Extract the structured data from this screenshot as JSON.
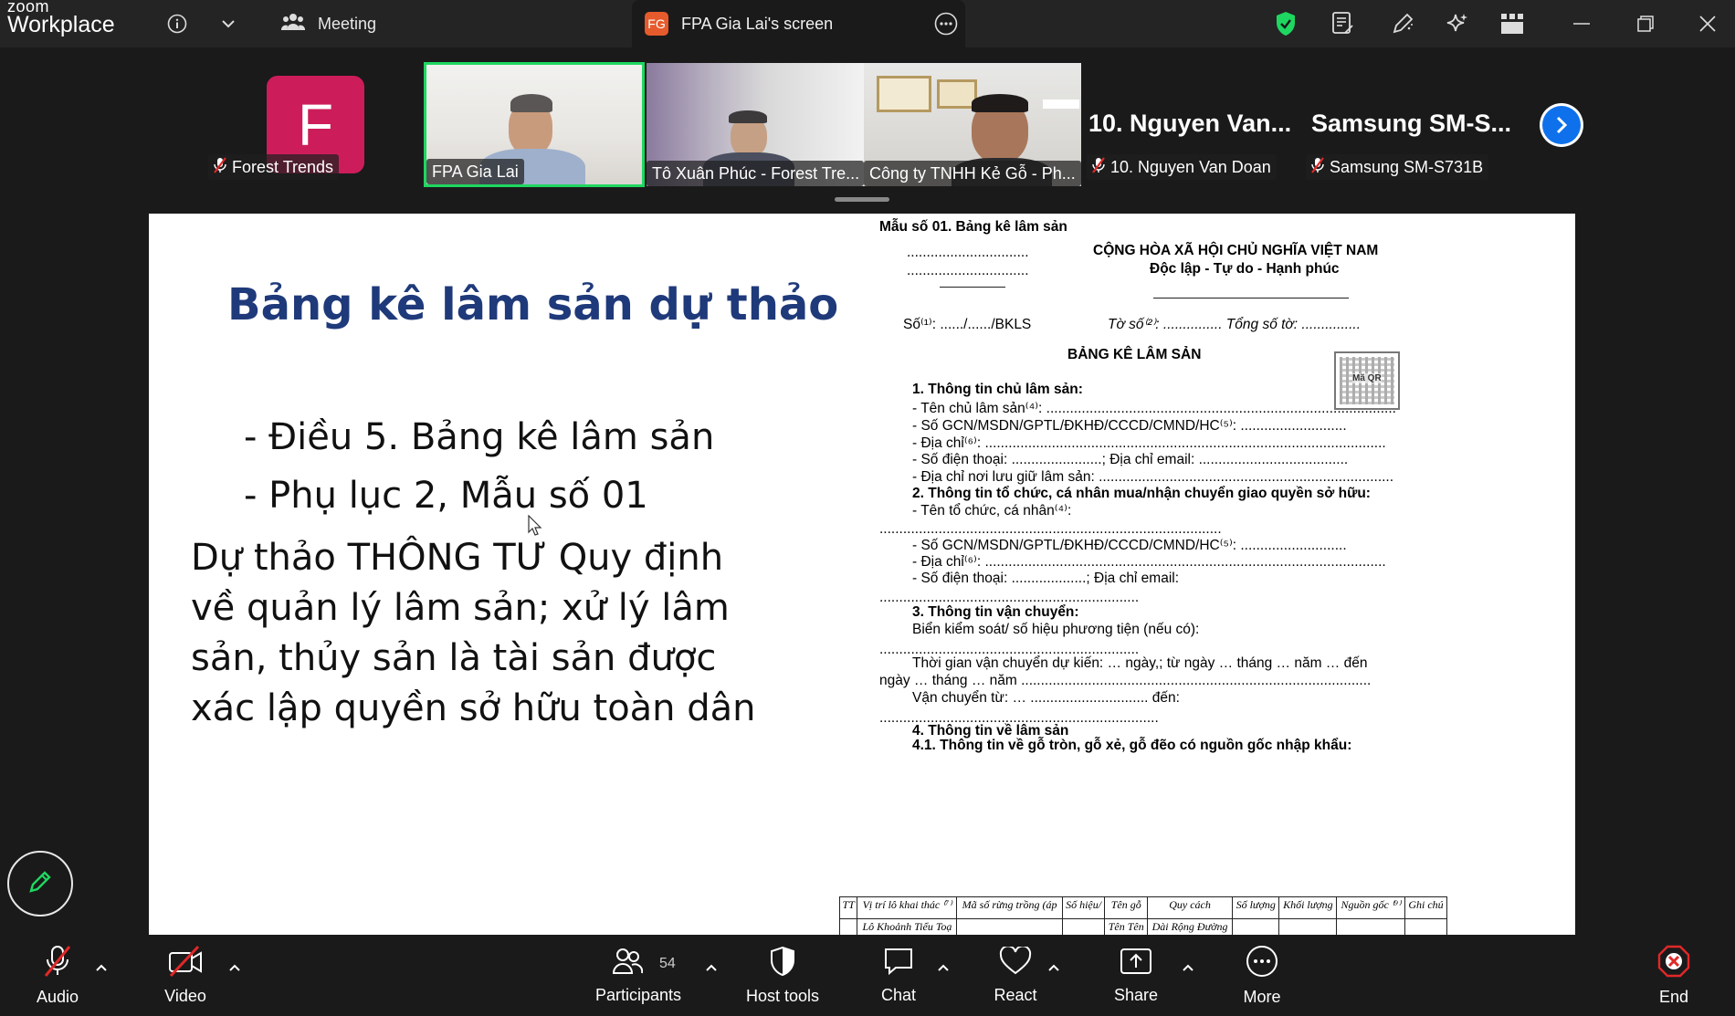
{
  "titlebar": {
    "brand_top": "zoom",
    "brand_bottom": "Workplace",
    "meeting_tab": "Meeting",
    "share_badge": "FG",
    "share_title": "FPA Gia Lai's screen"
  },
  "gallery": {
    "tiles": [
      {
        "label": "Forest Trends",
        "muted": true,
        "avatar_letter": "F"
      },
      {
        "label": "FPA Gia Lai",
        "muted": false,
        "active_speaker": true
      },
      {
        "label": "Tô Xuân Phúc - Forest Tre...",
        "muted": false
      },
      {
        "label": "Công ty TNHH Kẻ Gỗ - Ph...",
        "muted": false
      },
      {
        "label": "10. Nguyen Van Doan",
        "muted": true,
        "name_display": "10. Nguyen Van..."
      },
      {
        "label": "Samsung SM-S731B",
        "muted": true,
        "name_display": "Samsung SM-S..."
      }
    ]
  },
  "slide": {
    "title": "Bảng kê lâm sản dự thảo",
    "bullets": [
      "- Điều 5. Bảng kê lâm sản",
      "- Phụ lục 2, Mẫu số 01"
    ],
    "body": "Dự thảo THÔNG TƯ Quy định về quản lý lâm sản; xử lý lâm sản, thủy sản là tài sản được xác lập quyền sở hữu toàn dân"
  },
  "document": {
    "form_no": "Mẫu số 01. Bảng kê lâm sản",
    "dots_a": "...............................",
    "dots_b": "...............................",
    "nation": "CỘNG HÒA XÃ HỘI CHỦ NGHĨA VIỆT NAM",
    "motto": "Độc lập - Tự do - Hạnh phúc",
    "number_line": "Số⁽¹⁾: ....../....../BKLS",
    "sheet_line": "Tờ số⁽²⁾: ............... Tổng số tờ: ...............",
    "doc_title": "BẢNG KÊ LÂM SẢN",
    "qr_label": "Mã QR",
    "lines": [
      {
        "text": "1. Thông tin chủ lâm sản:",
        "bold": true
      },
      {
        "text": "- Tên chủ lâm sản⁽⁴⁾: ........................................................................................."
      },
      {
        "text": "- Số GCN/MSDN/GPTL/ĐKHĐ/CCCD/CMND/HC⁽⁵⁾: ..........................."
      },
      {
        "text": "- Địa chỉ⁽⁶⁾: ......................................................................................................"
      },
      {
        "text": "- Số điện thoại: .......................; Địa chỉ email: ......................................"
      },
      {
        "text": "- Địa chỉ nơi lưu giữ lâm sản: ..........................................................................."
      },
      {
        "text": "2. Thông tin tổ chức, cá nhân mua/nhận chuyển giao quyền sở hữu:",
        "bold": true
      },
      {
        "text": "- Tên tổ chức, cá nhân⁽⁴⁾:"
      },
      {
        "text": "......................................................................................."
      },
      {
        "text": "- Số GCN/MSDN/GPTL/ĐKHĐ/CCCD/CMND/HC⁽⁵⁾: ..........................."
      },
      {
        "text": "- Địa chỉ⁽⁶⁾: ......................................................................................................"
      },
      {
        "text": "- Số điện thoại: ...................; Địa chỉ email:"
      },
      {
        "text": ".................................................................."
      },
      {
        "text": "3. Thông tin vận chuyển:",
        "bold": true
      },
      {
        "text": "Biển kiểm soát/ số hiệu phương tiện (nếu có):"
      },
      {
        "text": ".................................................................."
      },
      {
        "text": "Thời gian vận chuyển dự kiến: … ngày,; từ ngày … tháng … năm … đến"
      },
      {
        "text": "ngày … tháng … năm ........................................................................................."
      },
      {
        "text": "Vận chuyển từ: … .............................. đến:"
      },
      {
        "text": "......................................................................."
      },
      {
        "text": "4. Thông tin về lâm sản",
        "bold": true
      },
      {
        "text": "4.1. Thông tin về gỗ tròn, gỗ xẻ, gỗ đẽo có nguồn gốc nhập khẩu:",
        "bold": true
      }
    ],
    "table_header": [
      "TT",
      "Vị trí lô khai thác ⁽⁷⁾",
      "Mã số rừng trồng (áp",
      "Số hiệu/",
      "Tên gỗ",
      "Quy cách",
      "Số lượng",
      "Khối lượng",
      "Nguồn gốc ⁽⁹⁾",
      "Ghi chú"
    ],
    "table_sub": [
      "",
      "Lô  Khoảnh  Tiểu  Toạ",
      "",
      "",
      "Tên  Tên",
      "Dài  Rộng  Đường",
      "",
      "",
      "",
      ""
    ]
  },
  "toolbar": {
    "audio": "Audio",
    "video": "Video",
    "participants": "Participants",
    "participants_count": "54",
    "host_tools": "Host tools",
    "chat": "Chat",
    "react": "React",
    "share": "Share",
    "more": "More",
    "end": "End"
  },
  "colors": {
    "accent_green": "#1ed760",
    "zoom_blue": "#0e71eb",
    "end_red": "#e02828",
    "slide_title": "#1f3a7a"
  }
}
